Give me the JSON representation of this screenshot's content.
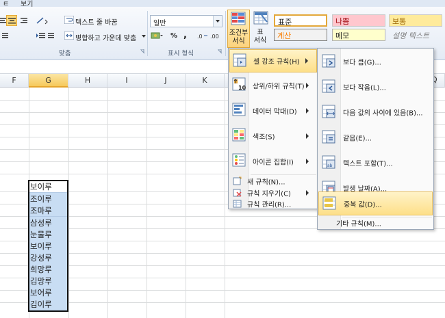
{
  "ribbon": {
    "tabs": [
      "ㅌ",
      "보기"
    ],
    "alignment": {
      "wrap_text": "텍스트 줄 바꿈",
      "merge_center": "병합하고 가운데 맞춤",
      "group_label": "맞춤"
    },
    "number": {
      "format_value": "일반",
      "percent": "%",
      "comma": ",",
      "group_label": "표시 형식"
    },
    "conditional_format": {
      "line1": "조건부",
      "line2": "서식"
    },
    "format_table": {
      "line1": "표",
      "line2": "서식"
    },
    "styles": {
      "normal": "표준",
      "bad": "나쁨",
      "neutral": "보통",
      "calculation": "계산",
      "note": "메모",
      "explanatory": "설명 텍스트"
    },
    "colors": {
      "bad_bg": "#ffc7ce",
      "bad_fg": "#9c0006",
      "neutral_bg": "#ffeb9c",
      "neutral_fg": "#9c6500",
      "calc_bg": "#f2f2f2",
      "calc_fg": "#fa7d00",
      "note_bg": "#ffffcc"
    }
  },
  "grid": {
    "columns": [
      "F",
      "G",
      "H",
      "I",
      "J",
      "K"
    ],
    "selected_column": "G",
    "cells": [
      "보이루",
      "조이루",
      "조마루",
      "삼성루",
      "눈물루",
      "보이루",
      "강성루",
      "희망루",
      "김망루",
      "보어루",
      "김이루"
    ]
  },
  "menu_main": {
    "items": [
      {
        "label": "셀 강조 규칙(H)",
        "icon": "highlight-cells-rules-icon"
      },
      {
        "label": "상위/하위 규칙(T)",
        "icon": "top-bottom-rules-icon"
      },
      {
        "label": "데이터 막대(D)",
        "icon": "data-bars-icon"
      },
      {
        "label": "색조(S)",
        "icon": "color-scales-icon"
      },
      {
        "label": "아이콘 집합(I)",
        "icon": "icon-sets-icon"
      }
    ],
    "small_items": [
      {
        "label": "새 규칙(N)...",
        "icon": "new-rule-icon"
      },
      {
        "label": "규칙 지우기(C)",
        "icon": "clear-rules-icon"
      },
      {
        "label": "규칙 관리(R)...",
        "icon": "manage-rules-icon"
      }
    ]
  },
  "menu_sub": {
    "items": [
      {
        "label": "보다 큼(G)...",
        "icon": "greater-than-icon"
      },
      {
        "label": "보다 작음(L)...",
        "icon": "less-than-icon"
      },
      {
        "label": "다음 값의 사이에 있음(B)...",
        "icon": "between-icon"
      },
      {
        "label": "같음(E)...",
        "icon": "equal-to-icon"
      },
      {
        "label": "텍스트 포함(T)...",
        "icon": "text-contains-icon"
      },
      {
        "label": "발생 날짜(A)...",
        "icon": "date-occurring-icon"
      },
      {
        "label": "중복 값(D)...",
        "icon": "duplicate-values-icon"
      }
    ],
    "more_rules": "기타 규칙(M)..."
  }
}
